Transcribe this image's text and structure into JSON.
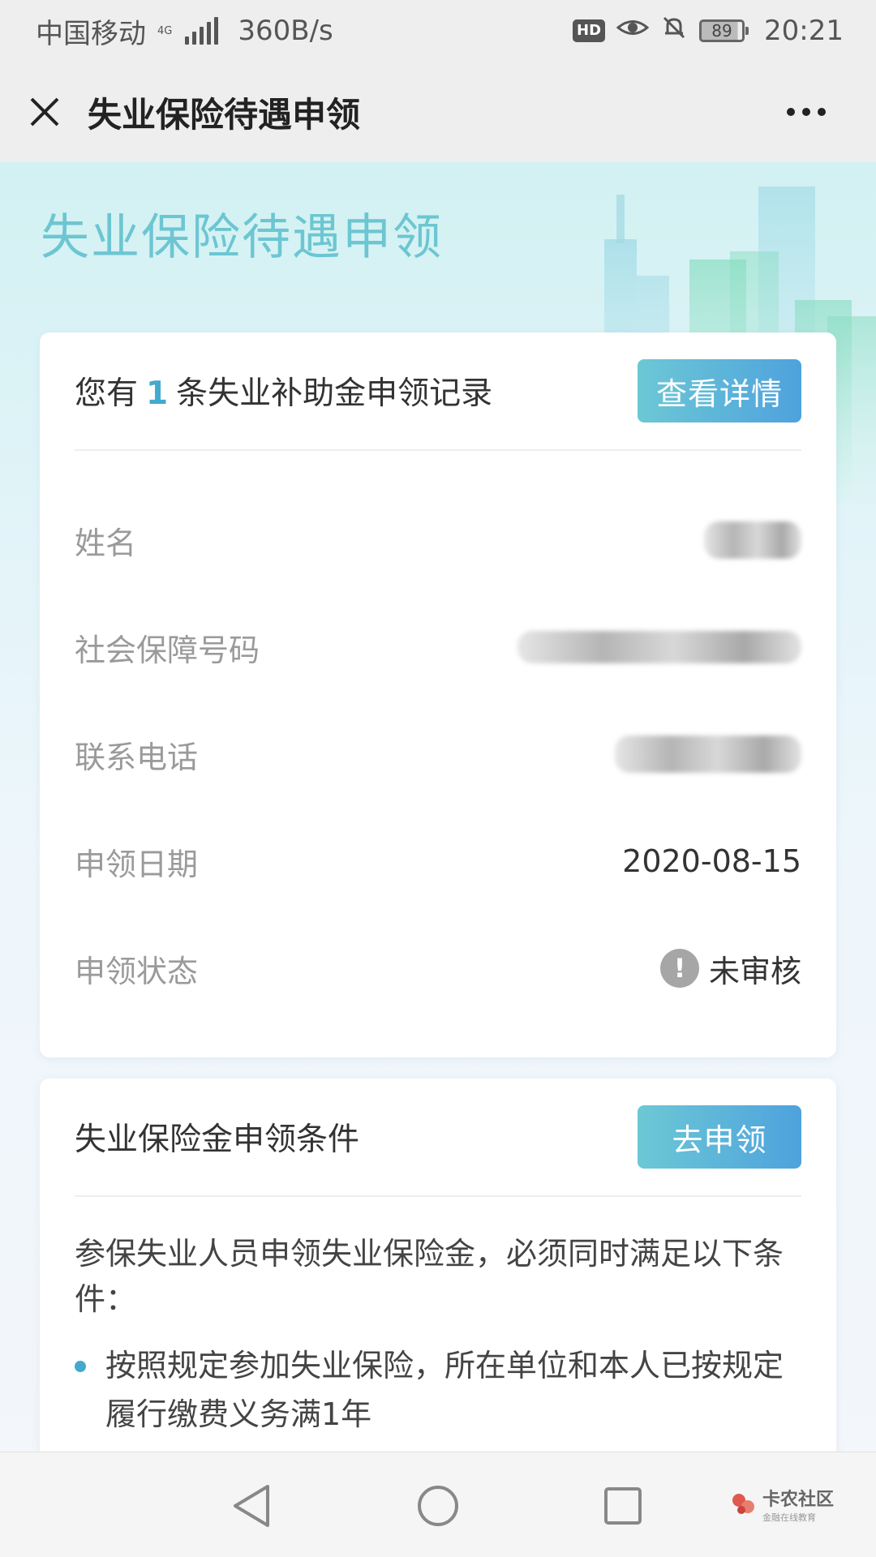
{
  "status_bar": {
    "carrier": "中国移动",
    "network": "4G",
    "speed": "360B/s",
    "hd": "HD",
    "battery": "89",
    "time": "20:21"
  },
  "title_bar": {
    "title": "失业保险待遇申领",
    "close_icon": "close-icon",
    "more_icon": "more-icon"
  },
  "hero": {
    "title": "失业保险待遇申领"
  },
  "record_card": {
    "prefix": "您有",
    "count": "1",
    "suffix": "条失业补助金申领记录",
    "button": "查看详情",
    "rows": [
      {
        "label": "姓名",
        "value": ""
      },
      {
        "label": "社会保障号码",
        "value": ""
      },
      {
        "label": "联系电话",
        "value": ""
      },
      {
        "label": "申领日期",
        "value": "2020-08-15"
      },
      {
        "label": "申领状态",
        "value": "未审核",
        "icon": "exclamation-icon"
      }
    ]
  },
  "conditions_card": {
    "title": "失业保险金申领条件",
    "button": "去申领",
    "intro": "参保失业人员申领失业保险金，必须同时满足以下条件：",
    "items": [
      "按照规定参加失业保险，所在单位和本人已按规定履行缴费义务满1年"
    ]
  },
  "watermark": {
    "title": "卡农社区",
    "subtitle": "金融在线教育"
  },
  "colors": {
    "accent": "#43a9cf",
    "hero_title": "#6cc6d2",
    "button_start": "#6cc8d5",
    "button_end": "#4ea2dd"
  }
}
